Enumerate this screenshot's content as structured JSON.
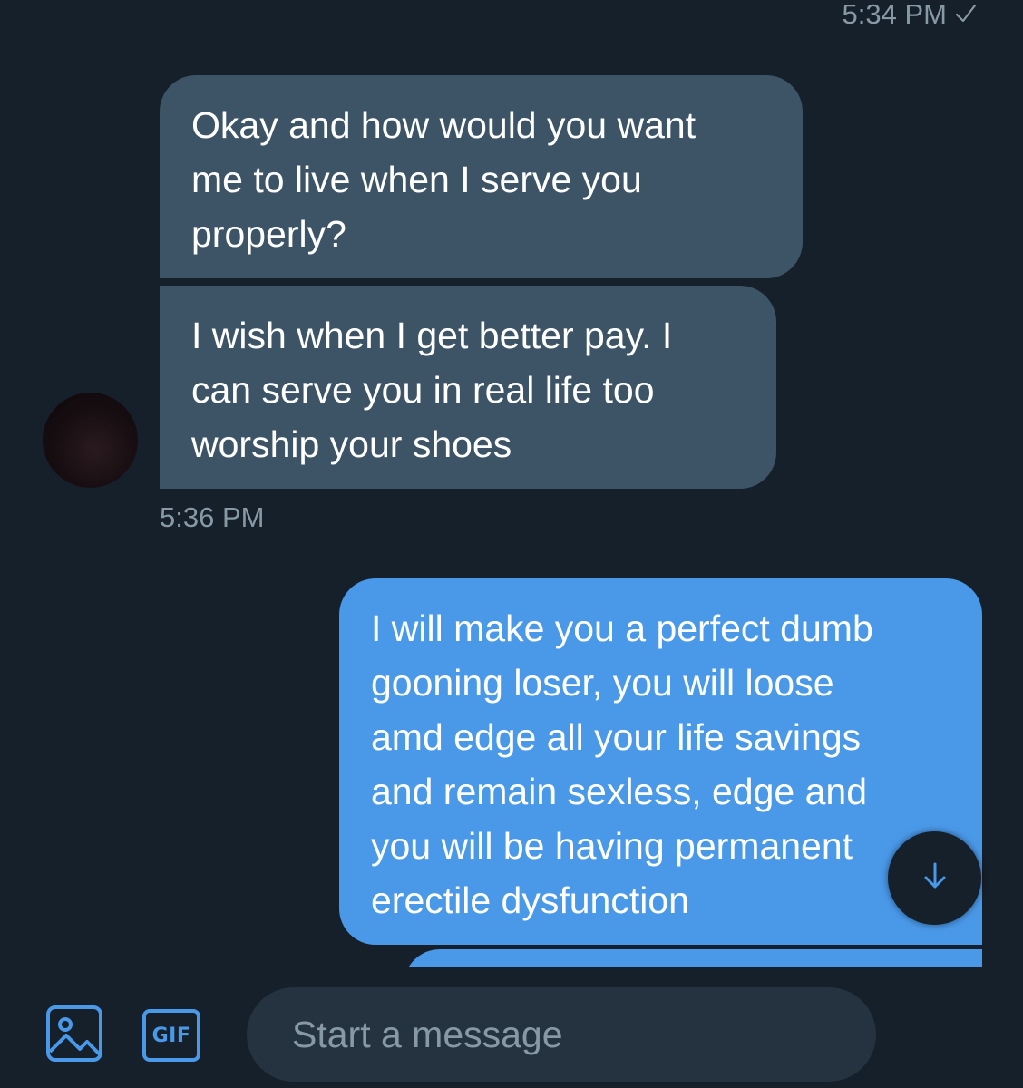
{
  "messages": {
    "sent_time_top": "5:34 PM",
    "received": [
      {
        "text": "Okay and how would you want\nme to live when I serve you\nproperly?"
      },
      {
        "text": "I wish when I get better pay. I\ncan serve you in real life too\nworship your shoes"
      }
    ],
    "received_time": "5:36 PM",
    "sent": [
      {
        "text": "I will make you a perfect dumb\ngooning loser, you will loose\namd edge all your life savings\nand remain sexless, edge and\nyou will be having permanent\nerectile dysfunction"
      }
    ]
  },
  "composer": {
    "media_icon": "image-icon",
    "gif_label": "GIF",
    "placeholder": "Start a message",
    "voice_icon": "voice-waveform-icon"
  },
  "colors": {
    "background": "#15202b",
    "received_bubble": "#3d5466",
    "sent_bubble": "#4a99e9",
    "accent": "#1d9bf0",
    "voice_icon": "#9b6bf2"
  }
}
